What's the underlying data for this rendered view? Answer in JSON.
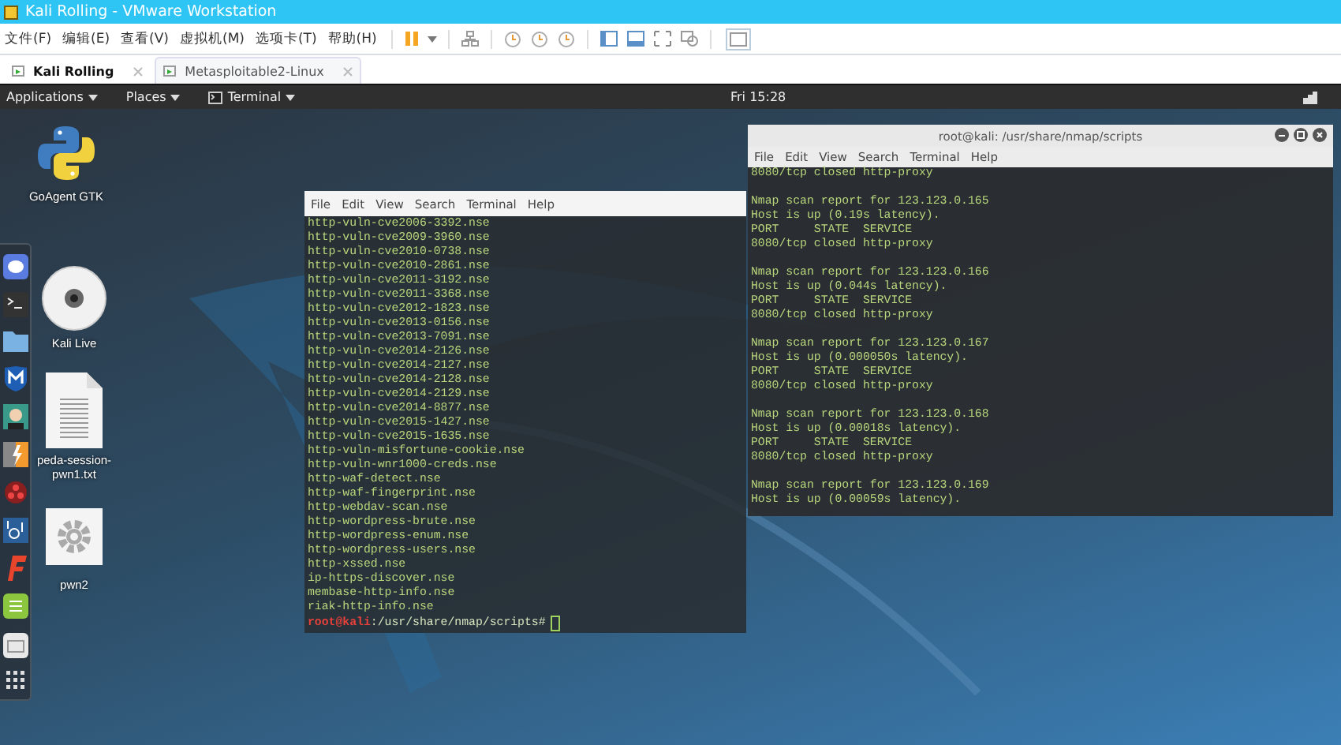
{
  "window": {
    "title": "Kali Rolling - VMware Workstation"
  },
  "menu": [
    "文件(F)",
    "编辑(E)",
    "查看(V)",
    "虚拟机(M)",
    "选项卡(T)",
    "帮助(H)"
  ],
  "vm_tabs": [
    {
      "label": "Kali Rolling",
      "selected": true
    },
    {
      "label": "Metasploitable2-Linux",
      "selected": false
    }
  ],
  "top_panel": {
    "menus": [
      "Applications",
      "Places",
      "Terminal"
    ],
    "clock": "Fri 15:28"
  },
  "desktop_icons": [
    {
      "kind": "python",
      "label": "GoAgent GTK"
    },
    {
      "kind": "disc",
      "label": "Kali Live"
    },
    {
      "kind": "document",
      "label": "peda-session-pwn1.txt"
    },
    {
      "kind": "gear",
      "label": "pwn2"
    }
  ],
  "left_terminal": {
    "menus": [
      "File",
      "Edit",
      "View",
      "Search",
      "Terminal",
      "Help"
    ],
    "lines": [
      "http-vuln-cve2006-3392.nse",
      "http-vuln-cve2009-3960.nse",
      "http-vuln-cve2010-0738.nse",
      "http-vuln-cve2010-2861.nse",
      "http-vuln-cve2011-3192.nse",
      "http-vuln-cve2011-3368.nse",
      "http-vuln-cve2012-1823.nse",
      "http-vuln-cve2013-0156.nse",
      "http-vuln-cve2013-7091.nse",
      "http-vuln-cve2014-2126.nse",
      "http-vuln-cve2014-2127.nse",
      "http-vuln-cve2014-2128.nse",
      "http-vuln-cve2014-2129.nse",
      "http-vuln-cve2014-8877.nse",
      "http-vuln-cve2015-1427.nse",
      "http-vuln-cve2015-1635.nse",
      "http-vuln-misfortune-cookie.nse",
      "http-vuln-wnr1000-creds.nse",
      "http-waf-detect.nse",
      "http-waf-fingerprint.nse",
      "http-webdav-scan.nse",
      "http-wordpress-brute.nse",
      "http-wordpress-enum.nse",
      "http-wordpress-users.nse",
      "http-xssed.nse",
      "ip-https-discover.nse",
      "membase-http-info.nse",
      "riak-http-info.nse"
    ],
    "prompt": {
      "user": "root@kali",
      "path": ":/usr/share/nmap/scripts#"
    }
  },
  "right_terminal": {
    "title": "root@kali: /usr/share/nmap/scripts",
    "menus": [
      "File",
      "Edit",
      "View",
      "Search",
      "Terminal",
      "Help"
    ],
    "first_line": "8080/tcp closed http-proxy",
    "reports": [
      {
        "lines": [
          "Nmap scan report for 123.123.0.165",
          "Host is up (0.19s latency).",
          "PORT     STATE  SERVICE",
          "8080/tcp closed http-proxy"
        ]
      },
      {
        "lines": [
          "Nmap scan report for 123.123.0.166",
          "Host is up (0.044s latency).",
          "PORT     STATE  SERVICE",
          "8080/tcp closed http-proxy"
        ]
      },
      {
        "lines": [
          "Nmap scan report for 123.123.0.167",
          "Host is up (0.000050s latency).",
          "PORT     STATE  SERVICE",
          "8080/tcp closed http-proxy"
        ]
      },
      {
        "lines": [
          "Nmap scan report for 123.123.0.168",
          "Host is up (0.00018s latency).",
          "PORT     STATE  SERVICE",
          "8080/tcp closed http-proxy"
        ]
      },
      {
        "lines": [
          "Nmap scan report for 123.123.0.169",
          "Host is up (0.00059s latency)."
        ]
      }
    ]
  }
}
